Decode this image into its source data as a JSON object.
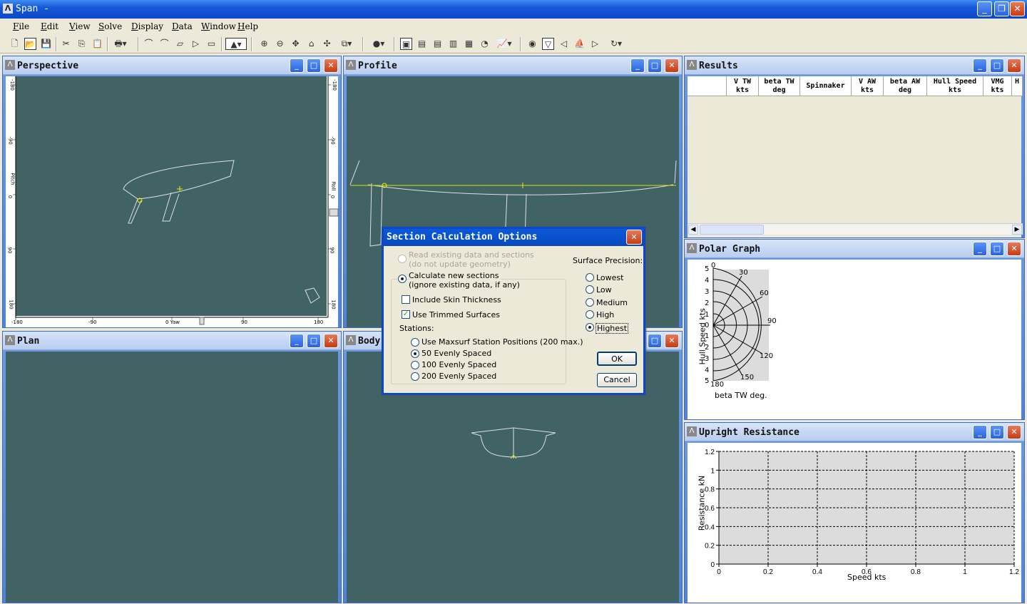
{
  "app": {
    "title": "Span -"
  },
  "menu": [
    "File",
    "Edit",
    "View",
    "Solve",
    "Display",
    "Data",
    "Window",
    "Help"
  ],
  "panes": {
    "perspective": {
      "title": "Perspective",
      "ticks_left": [
        "-180",
        "-90",
        "0",
        "90",
        "180"
      ],
      "ticks_right": [
        "-180",
        "-90",
        "0",
        "90",
        "180"
      ],
      "ticks_bottom": [
        "-180",
        "-90",
        "0 Yaw",
        "90",
        "180"
      ],
      "left_axis": "Pitch",
      "right_axis": "Roll"
    },
    "profile": {
      "title": "Profile"
    },
    "plan": {
      "title": "Plan"
    },
    "body": {
      "title": "Body"
    },
    "results": {
      "title": "Results",
      "columns": [
        "",
        "V TW\nkts",
        "beta TW\ndeg",
        "Spinnaker",
        "V AW\nkts",
        "beta AW\ndeg",
        "Hull Speed\nkts",
        "VMG\nkts",
        "H"
      ]
    },
    "polar": {
      "title": "Polar Graph",
      "ylabel": "Hull Speed  kts",
      "xlabel": "beta TW  deg.",
      "radial": [
        "5",
        "4",
        "3",
        "2",
        "1",
        "0",
        "1",
        "2",
        "3",
        "4",
        "5"
      ],
      "angles": [
        "0",
        "30",
        "60",
        "90",
        "120",
        "150",
        "180"
      ]
    },
    "upright": {
      "title": "Upright Resistance"
    }
  },
  "dialog": {
    "title": "Section Calculation Options",
    "opt_read": "Read existing data and sections",
    "opt_read_sub": "(do not update geometry)",
    "opt_calc": "Calculate new sections",
    "opt_calc_sub": "(ignore existing data, if any)",
    "chk_skin": "Include Skin Thickness",
    "chk_trim": "Use Trimmed Surfaces",
    "stations_label": "Stations:",
    "stations": [
      "Use Maxsurf Station Positions (200 max.)",
      "50 Evenly Spaced",
      "100 Evenly Spaced",
      "200 Evenly Spaced"
    ],
    "precision_label": "Surface Precision:",
    "precision": [
      "Lowest",
      "Low",
      "Medium",
      "High",
      "Highest"
    ],
    "ok": "OK",
    "cancel": "Cancel",
    "selected_station": "50 Evenly Spaced",
    "selected_precision": "Highest"
  },
  "chart_data": {
    "type": "line",
    "title": "",
    "xlabel": "Speed  kts",
    "ylabel": "Resistance  kN",
    "xlim": [
      0,
      1.2
    ],
    "ylim": [
      0,
      1.2
    ],
    "x_ticks": [
      "0",
      "0.2",
      "0.4",
      "0.6",
      "0.8",
      "1",
      "1.2"
    ],
    "y_ticks": [
      "0",
      "0.2",
      "0.4",
      "0.6",
      "0.8",
      "1",
      "1.2"
    ],
    "grid": true,
    "series": []
  },
  "colors": {
    "canvas": "#416363",
    "accent": "#0a48c8"
  }
}
